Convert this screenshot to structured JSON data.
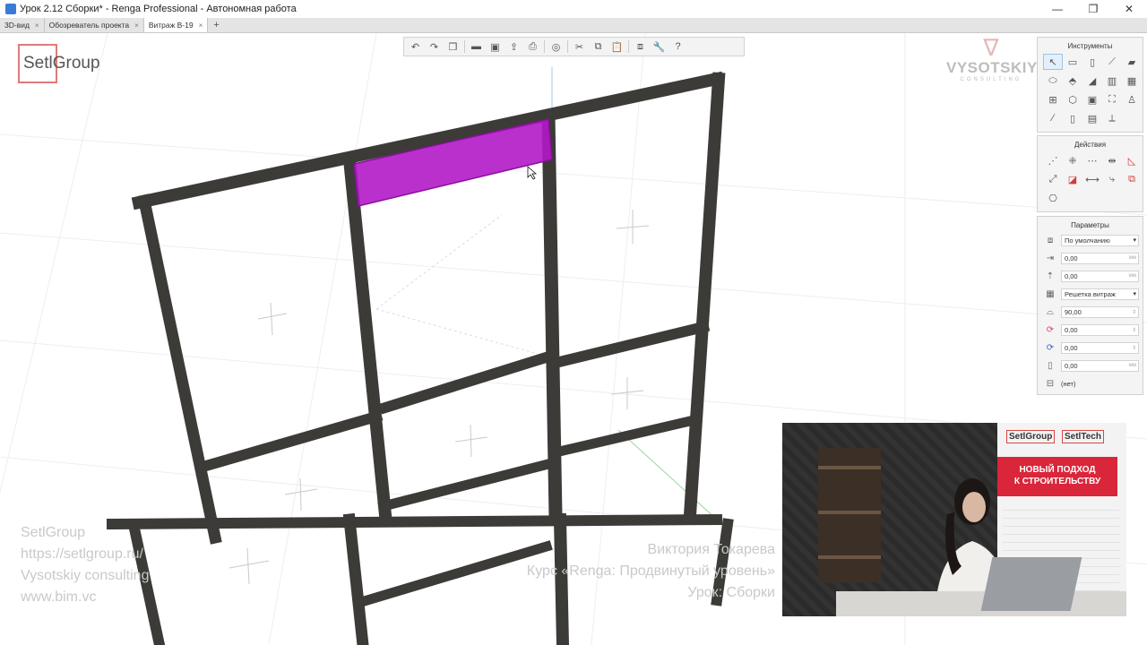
{
  "window": {
    "title": "Урок 2.12 Сборки* - Renga Professional - Автономная работа",
    "controls": {
      "minimize": "—",
      "maximize": "❐",
      "close": "✕"
    }
  },
  "tabs": [
    {
      "label": "3D-вид",
      "close": "×",
      "active": false
    },
    {
      "label": "Обозреватель проекта",
      "close": "×",
      "active": false
    },
    {
      "label": "Витраж В-19",
      "close": "×",
      "active": true
    }
  ],
  "tab_add": "+",
  "branding": {
    "setgroup": "SetlGroup",
    "vysotskiy": "VYSOTSKIY",
    "vysotskiy_sub": "CONSULTING"
  },
  "watermark_left": [
    "SetlGroup",
    "https://setlgroup.ru/",
    "Vysotskiy consulting",
    "www.bim.vc"
  ],
  "watermark_right": [
    "Виктория Токарева",
    "Курс «Renga: Продвинутый уровень»",
    "Урок: Сборки"
  ],
  "panels": {
    "tools": {
      "title": "Инструменты"
    },
    "actions": {
      "title": "Действия"
    },
    "params": {
      "title": "Параметры",
      "unit": "мм",
      "rows": [
        {
          "icon": "style-icon",
          "value": "По умолчанию",
          "type": "select"
        },
        {
          "icon": "offset-icon",
          "value": "0,00",
          "type": "number"
        },
        {
          "icon": "height-icon",
          "value": "0,00",
          "type": "number"
        },
        {
          "icon": "grid-icon",
          "value": "Решетка витраж",
          "type": "select"
        },
        {
          "icon": "angle-icon",
          "value": "90,00",
          "type": "spin"
        },
        {
          "icon": "rotate-x-icon",
          "value": "0,00",
          "type": "spin"
        },
        {
          "icon": "rotate-y-icon",
          "value": "0,00",
          "type": "spin"
        },
        {
          "icon": "thickness-icon",
          "value": "0,00",
          "type": "number"
        },
        {
          "icon": "mark-icon",
          "value": "(нет)",
          "type": "plain"
        }
      ]
    }
  },
  "video": {
    "brand_left": "SetlGroup",
    "brand_right": "SetlTech",
    "slogan_line1": "НОВЫЙ ПОДХОД",
    "slogan_line2": "К СТРОИТЕЛЬСТВУ"
  },
  "colors": {
    "selection": "#b21ac6",
    "frame": "#3c3b38",
    "accent": "#d9263a"
  }
}
